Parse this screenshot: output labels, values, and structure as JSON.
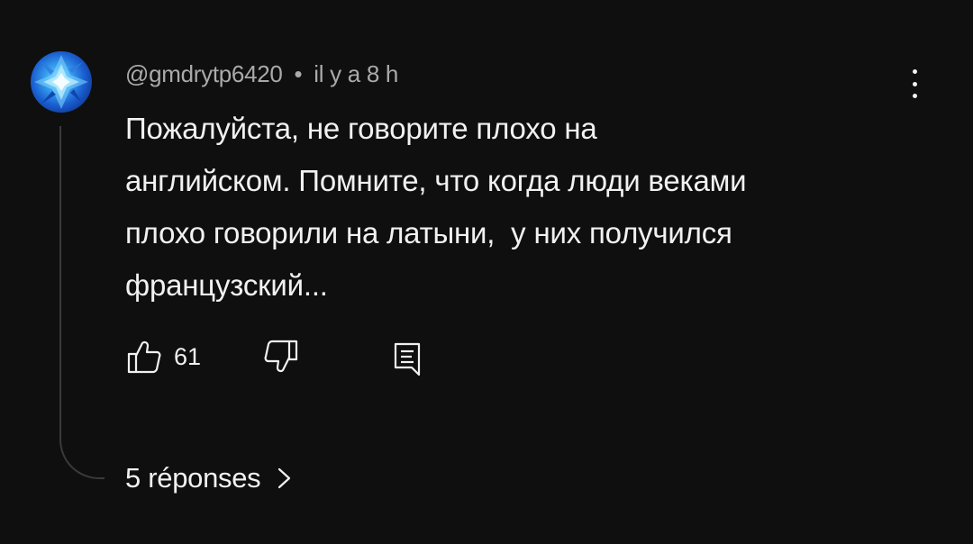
{
  "comment": {
    "author": "@gmdrytp6420",
    "separator": "•",
    "time": "il y a 8 h",
    "text_lines": [
      "Пожалуйста, не говорите плохо на",
      "английском. Помните, что когда люди веками",
      "плохо говорили на латыни,  у них получился",
      "французский..."
    ],
    "likes": "61",
    "replies_label": "5 réponses"
  },
  "icons": {
    "avatar": "crystal-avatar",
    "menu": "more-vertical-icon",
    "like": "thumb-up-icon",
    "dislike": "thumb-down-icon",
    "reply": "reply-comment-icon",
    "expand": "chevron-right-icon"
  },
  "colors": {
    "background": "#0f0f0f",
    "text_primary": "#f1f1f1",
    "text_secondary": "#aaaaaa",
    "thread_line": "#3a3a3a"
  }
}
